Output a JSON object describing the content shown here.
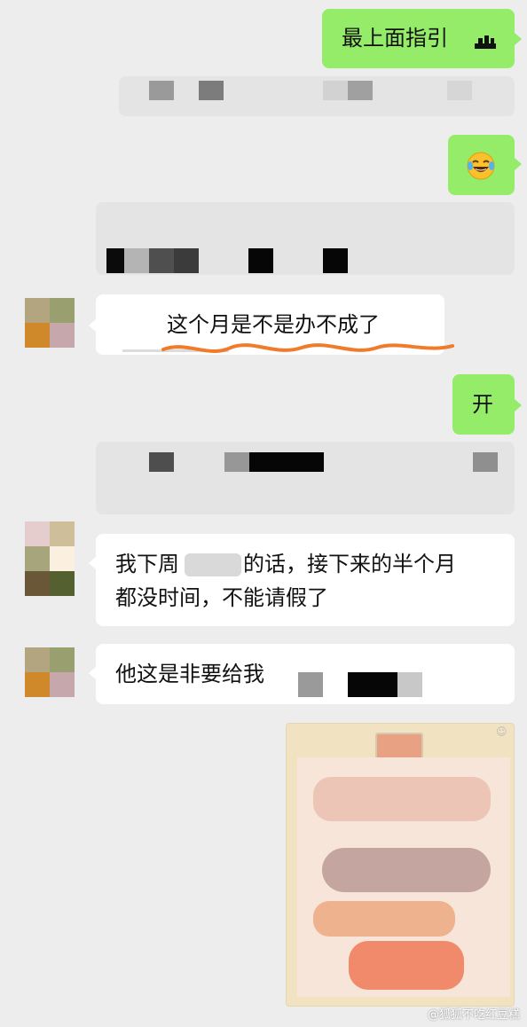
{
  "messages": {
    "m1": "最上面指引",
    "m4": "这个月是不是办不成了",
    "m5": "开",
    "m7_line1_a": "我下周",
    "m7_line1_b": "的话，接下来的半个月",
    "m7_line2": "都没时间，不能请假了",
    "m8": "他这是非要给我"
  },
  "icons": {
    "sticker_suffix": "ship-emoji-icon",
    "laugh_cry": "laughing-crying-emoji-icon"
  },
  "watermark": "@狐狐不吃红豆糕",
  "colors": {
    "outgoing": "#95ec69",
    "incoming": "#ffffff",
    "background": "#ededed",
    "underline": "#f07b2b"
  }
}
